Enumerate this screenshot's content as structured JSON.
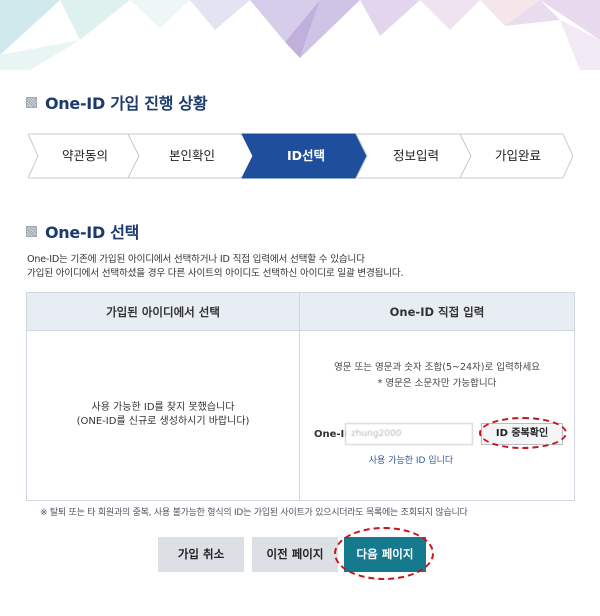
{
  "progress": {
    "title": "One-ID 가입 진행 상황",
    "steps": [
      {
        "label": "약관동의",
        "active": false
      },
      {
        "label": "본인확인",
        "active": false
      },
      {
        "label": "ID선택",
        "active": true
      },
      {
        "label": "정보입력",
        "active": false
      },
      {
        "label": "가입완료",
        "active": false
      }
    ]
  },
  "selection": {
    "title": "One-ID 선택",
    "desc_line1": "One-ID는 기존에 가입된 아이디에서 선택하거나 ID 직접 입력에서 선택할 수 있습니다",
    "desc_line2": "가입된 아이디에서 선택하셨을 경우 다른 사이트의 아이디도 선택하신 아이디로 일괄 변경됩니다."
  },
  "panel": {
    "left_header": "가입된 아이디에서 선택",
    "right_header": "One-ID 직접 입력",
    "left_msg_line1": "사용 가능한 ID를 찾지 못했습니다",
    "left_msg_line2": "(ONE-ID를 신규로 생성하시기 바랍니다)",
    "rule_line1": "영문 또는 영문과 숫자 조합(5~24자)로 입력하세요",
    "rule_line2": "* 영문은 소문자만 가능합니다",
    "id_label": "One-ID",
    "id_value": "zhung2000",
    "check_button": "ID 중복확인",
    "available_msg": "사용 가능한 ID 입니다"
  },
  "notice": "※ 탈퇴 또는 타 회원과의 중복, 사용 불가능한 형식의 ID는 가입된 사이트가 있으시더라도 목록에는 조회되지 않습니다",
  "buttons": {
    "cancel": "가입 취소",
    "prev": "이전 페이지",
    "next": "다음 페이지"
  },
  "colors": {
    "accent_navy": "#1f4e9c",
    "title_navy": "#1c3a6e",
    "teal_button": "#157a8e",
    "highlight_red": "#c9141a"
  }
}
